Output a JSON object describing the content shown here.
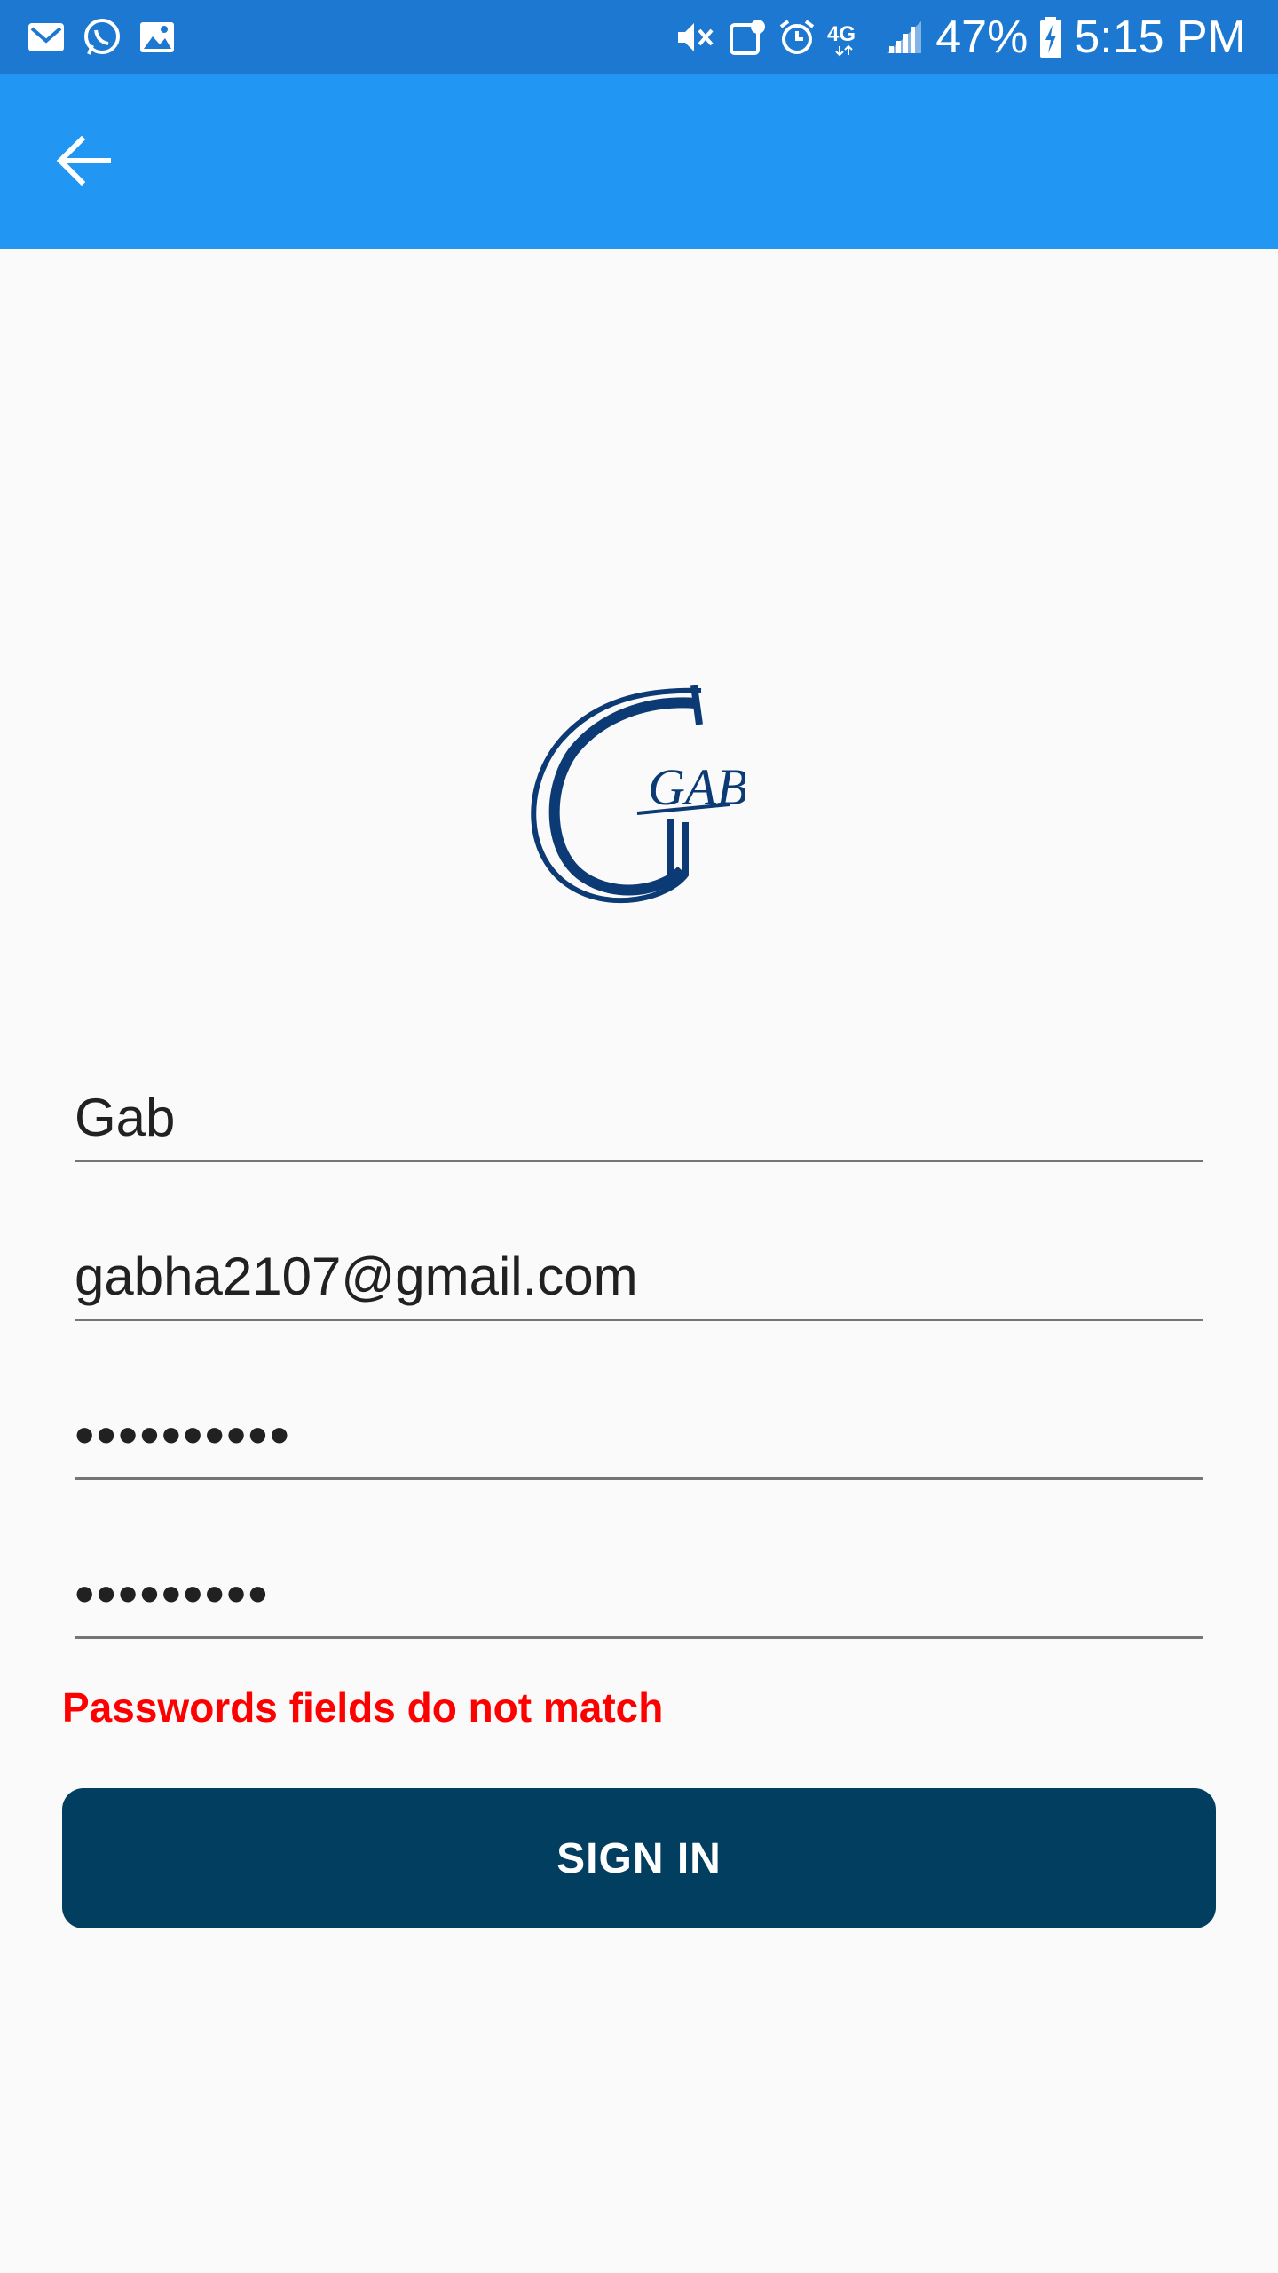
{
  "status_bar": {
    "battery": "47%",
    "time": "5:15 PM",
    "network": "4G",
    "icons_left": [
      "gmail-icon",
      "whatsapp-icon",
      "gallery-icon"
    ],
    "icons_right": [
      "mute-icon",
      "volte-icon",
      "alarm-icon",
      "network-4g-icon",
      "signal-icon",
      "battery-charging-icon"
    ]
  },
  "app_bar": {
    "back_icon": "arrow-back-icon"
  },
  "logo": {
    "icon": "gab-logo",
    "text": "GAB",
    "color": "#0b3a74"
  },
  "form": {
    "name_value": "Gab",
    "email_value": "gabha2107@gmail.com",
    "password_value": "••••••••••",
    "confirm_password_value": "•••••••••",
    "error": "Passwords fields do not match",
    "submit_label": "SIGN IN"
  },
  "colors": {
    "status_bar": "#1c78d1",
    "app_bar": "#2196f3",
    "button": "#023e5f",
    "error": "#ff0000",
    "background": "#fafafa"
  }
}
